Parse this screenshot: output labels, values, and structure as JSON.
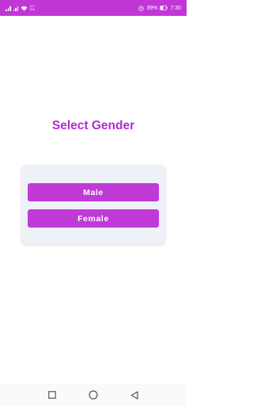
{
  "status_bar": {
    "net_speed_value": "0.0",
    "net_speed_unit": "K/s",
    "battery": "39%",
    "time": "7:30"
  },
  "screen": {
    "title": "Select Gender",
    "buttons": {
      "male": "Male",
      "female": "Female"
    }
  },
  "colors": {
    "accent": "#c03ad8",
    "status_bar": "#c236d6",
    "title": "#b22bd1",
    "card_background": "#eff1f8"
  },
  "nav_bar": {
    "icons": [
      "square-recents-icon",
      "circle-home-icon",
      "triangle-back-icon"
    ]
  }
}
